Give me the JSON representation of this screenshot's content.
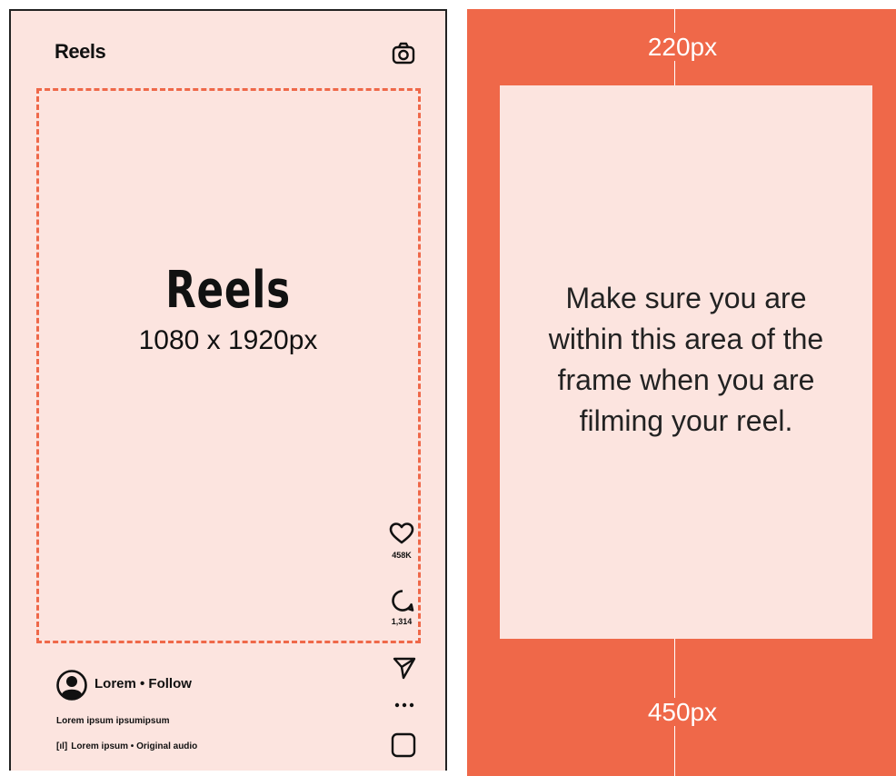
{
  "phone": {
    "header_title": "Reels",
    "camera_icon": "camera-icon",
    "format_title": "Reels",
    "format_dims": "1080 x 1920px",
    "likes": "458K",
    "comments": "1,314",
    "username_line": "Lorem • Follow",
    "caption": "Lorem ipsum ipsumipsum",
    "audio": "Lorem ipsum • Original audio",
    "icons": [
      "heart-icon",
      "comment-icon",
      "send-icon",
      "more-icon",
      "audio-thumb-icon"
    ]
  },
  "guide": {
    "top_margin": "220px",
    "bottom_margin": "450px",
    "message": "Make sure you are within this area of the frame when you are filming your reel."
  },
  "colors": {
    "accent": "#ef6849",
    "panel_bg": "#fce4df",
    "text": "#111111"
  }
}
